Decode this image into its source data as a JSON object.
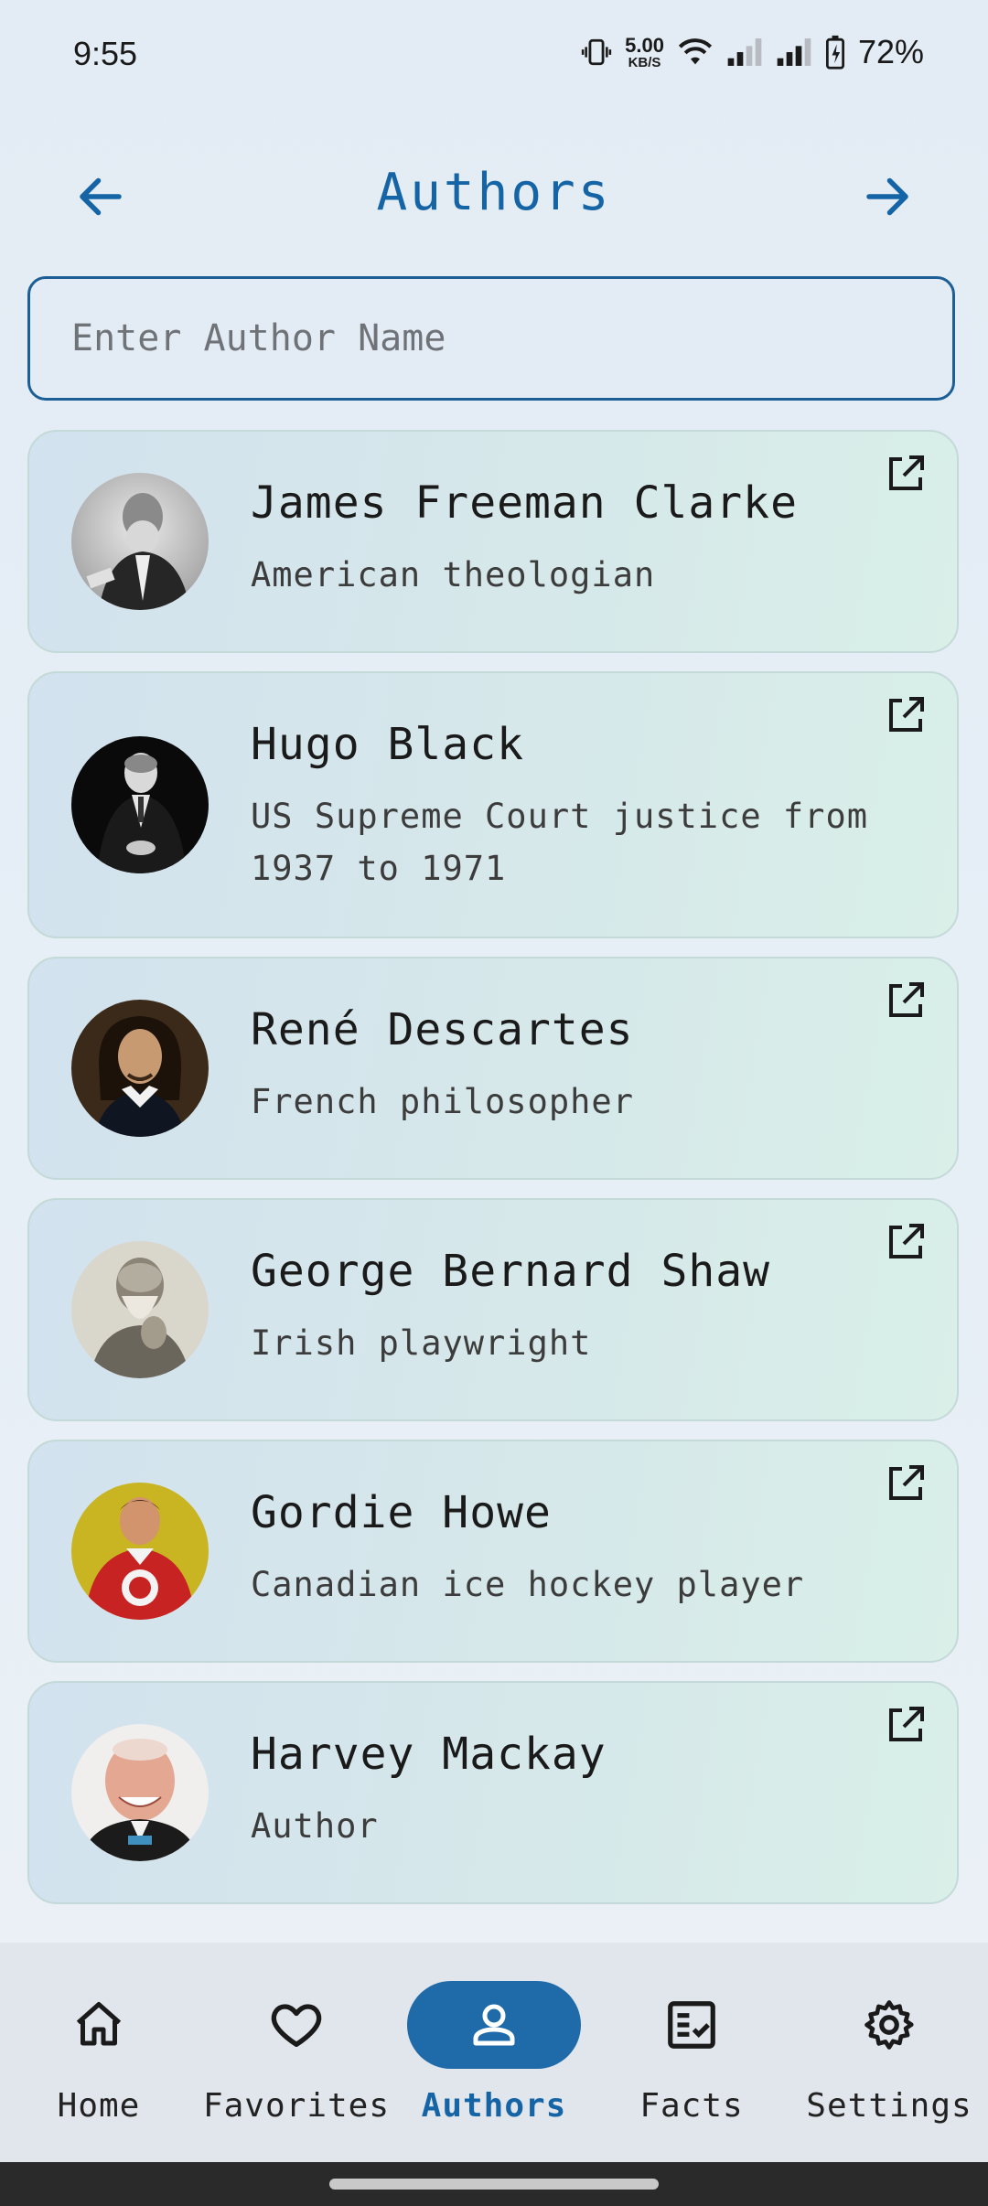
{
  "status_bar": {
    "time": "9:55",
    "net_speed_value": "5.00",
    "net_speed_unit": "KB/S",
    "battery": "72%"
  },
  "header": {
    "title": "Authors",
    "back_icon": "arrow-left-icon",
    "forward_icon": "arrow-right-icon"
  },
  "search": {
    "placeholder": "Enter Author Name",
    "value": ""
  },
  "authors": [
    {
      "name": "James Freeman Clarke",
      "description": "American theologian"
    },
    {
      "name": "Hugo Black",
      "description": "US Supreme Court justice from 1937 to 1971"
    },
    {
      "name": "René Descartes",
      "description": "French philosopher"
    },
    {
      "name": "George Bernard Shaw",
      "description": "Irish playwright"
    },
    {
      "name": "Gordie Howe",
      "description": "Canadian ice hockey player"
    },
    {
      "name": "Harvey Mackay",
      "description": "Author"
    }
  ],
  "bottom_nav": {
    "items": [
      {
        "label": "Home",
        "icon": "home-icon"
      },
      {
        "label": "Favorites",
        "icon": "heart-icon"
      },
      {
        "label": "Authors",
        "icon": "person-icon",
        "active": true
      },
      {
        "label": "Facts",
        "icon": "checklist-icon"
      },
      {
        "label": "Settings",
        "icon": "gear-icon"
      }
    ]
  },
  "colors": {
    "accent": "#1565a6",
    "active_nav_bg": "#1f6aa8",
    "card_border": "#c3dad8"
  }
}
